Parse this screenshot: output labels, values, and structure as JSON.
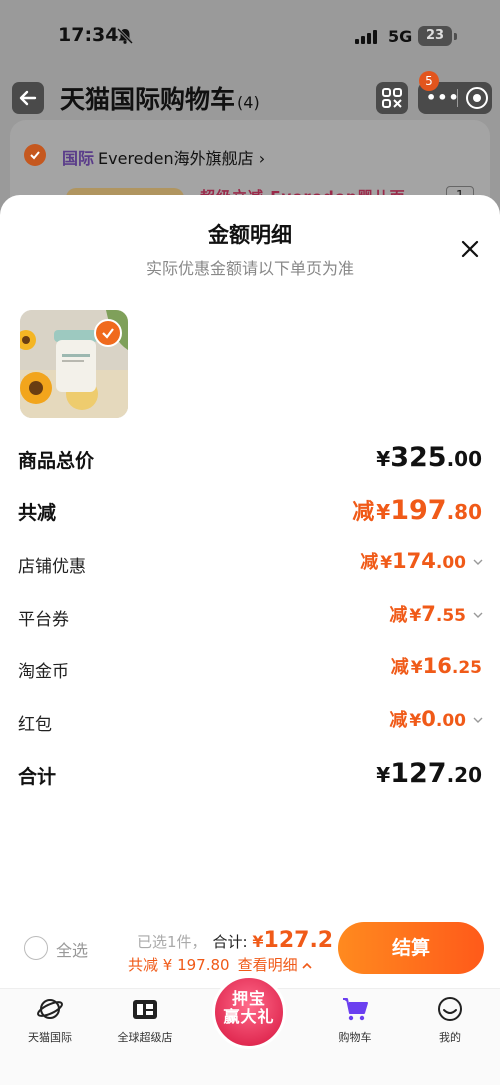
{
  "status_bar": {
    "time": "17:34",
    "network": "5G",
    "battery": "23"
  },
  "nav": {
    "title": "天猫国际购物车",
    "count": "(4)",
    "badge": "5"
  },
  "store": {
    "tag": "国际",
    "name": "Evereden海外旗舰店",
    "product_text": "超级立减 Evereden婴儿面",
    "qty": "1"
  },
  "sheet": {
    "title": "金额明细",
    "subtitle": "实际优惠金额请以下单页为准",
    "rows": [
      {
        "label": "商品总价",
        "prefix": "",
        "currency": "¥",
        "integer": "325",
        "decimal": ".00"
      },
      {
        "label": "共减",
        "prefix": "减",
        "currency": "¥",
        "integer": "197",
        "decimal": ".80"
      },
      {
        "label": "店铺优惠",
        "prefix": "减",
        "currency": "¥",
        "integer": "174",
        "decimal": ".00"
      },
      {
        "label": "平台券",
        "prefix": "减",
        "currency": "¥",
        "integer": "7",
        "decimal": ".55"
      },
      {
        "label": "淘金币",
        "prefix": "减",
        "currency": "¥",
        "integer": "16",
        "decimal": ".25"
      },
      {
        "label": "红包",
        "prefix": "减",
        "currency": "¥",
        "integer": "0",
        "decimal": ".00"
      },
      {
        "label": "合计",
        "prefix": "",
        "currency": "¥",
        "integer": "127",
        "decimal": ".20"
      }
    ]
  },
  "checkout": {
    "select_all": "全选",
    "selected": "已选1件，",
    "total_label": "合计:",
    "total_currency": "¥",
    "total_value": "127.2",
    "discount": "共减 ¥ 197.80",
    "detail_link": "查看明细",
    "button": "结算"
  },
  "tabs": [
    {
      "label": "天猫国际",
      "icon": "planet-icon"
    },
    {
      "label": "全球超级店",
      "icon": "self-operated-icon"
    },
    {
      "label": "购物车",
      "icon": "cart-icon"
    },
    {
      "label": "我的",
      "icon": "smile-icon"
    }
  ],
  "promo": {
    "line1": "押宝",
    "line2": "赢大礼"
  },
  "colors": {
    "accent": "#f05a18",
    "checkout_gradient_start": "#ff8a1f",
    "checkout_gradient_end": "#ff5a1a",
    "cart_tab": "#6b3ff0"
  }
}
